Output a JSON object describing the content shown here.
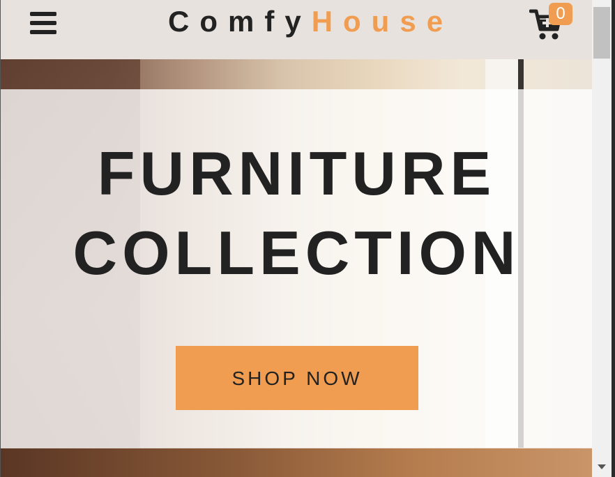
{
  "navbar": {
    "logo_part1": "Comfy",
    "logo_part2": "House",
    "cart_count": "0"
  },
  "hero": {
    "title_line1": "FURNITURE",
    "title_line2": "COLLECTION",
    "button_label": "SHOP NOW"
  },
  "icons": {
    "menu": "menu-icon",
    "cart": "cart-icon"
  },
  "colors": {
    "accent": "#f09d51",
    "navbar_bg": "#e8e2de",
    "text_dark": "#222222"
  }
}
